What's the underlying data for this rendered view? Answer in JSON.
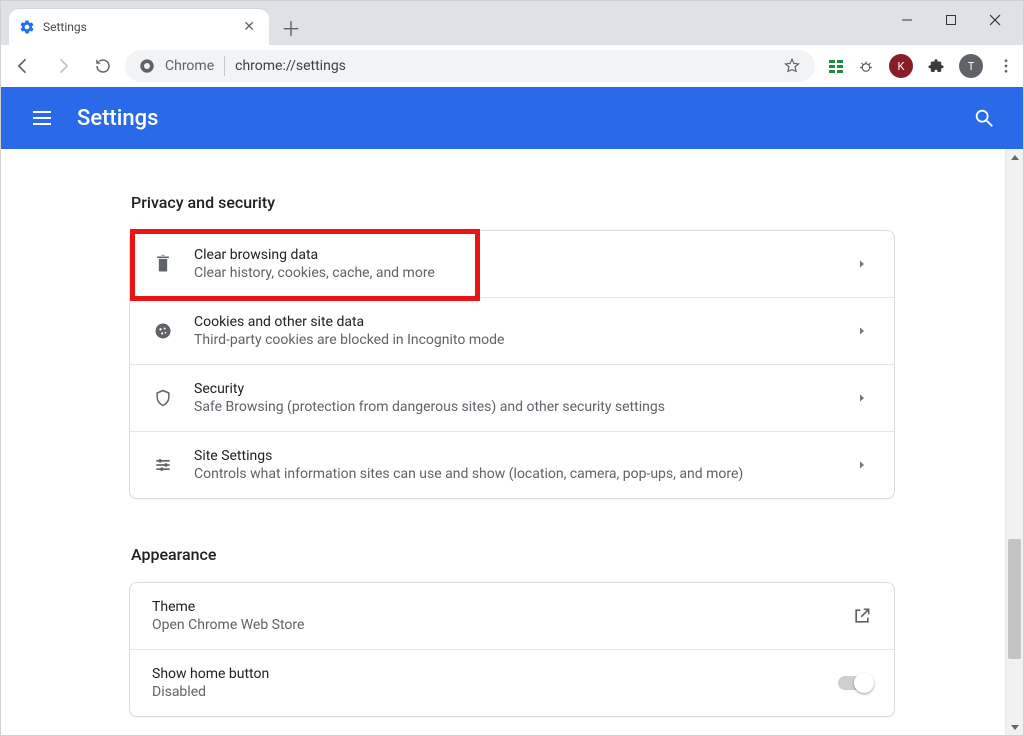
{
  "tab": {
    "title": "Settings"
  },
  "omnibox": {
    "scheme_label": "Chrome",
    "url": "chrome://settings"
  },
  "profile_initials": {
    "k": "K",
    "t": "T"
  },
  "settings_header": "Settings",
  "sections": {
    "privacy": {
      "title": "Privacy and security",
      "items": [
        {
          "title": "Clear browsing data",
          "sub": "Clear history, cookies, cache, and more"
        },
        {
          "title": "Cookies and other site data",
          "sub": "Third-party cookies are blocked in Incognito mode"
        },
        {
          "title": "Security",
          "sub": "Safe Browsing (protection from dangerous sites) and other security settings"
        },
        {
          "title": "Site Settings",
          "sub": "Controls what information sites can use and show (location, camera, pop-ups, and more)"
        }
      ]
    },
    "appearance": {
      "title": "Appearance",
      "theme": {
        "title": "Theme",
        "sub": "Open Chrome Web Store"
      },
      "home_button": {
        "title": "Show home button",
        "sub": "Disabled"
      }
    }
  }
}
